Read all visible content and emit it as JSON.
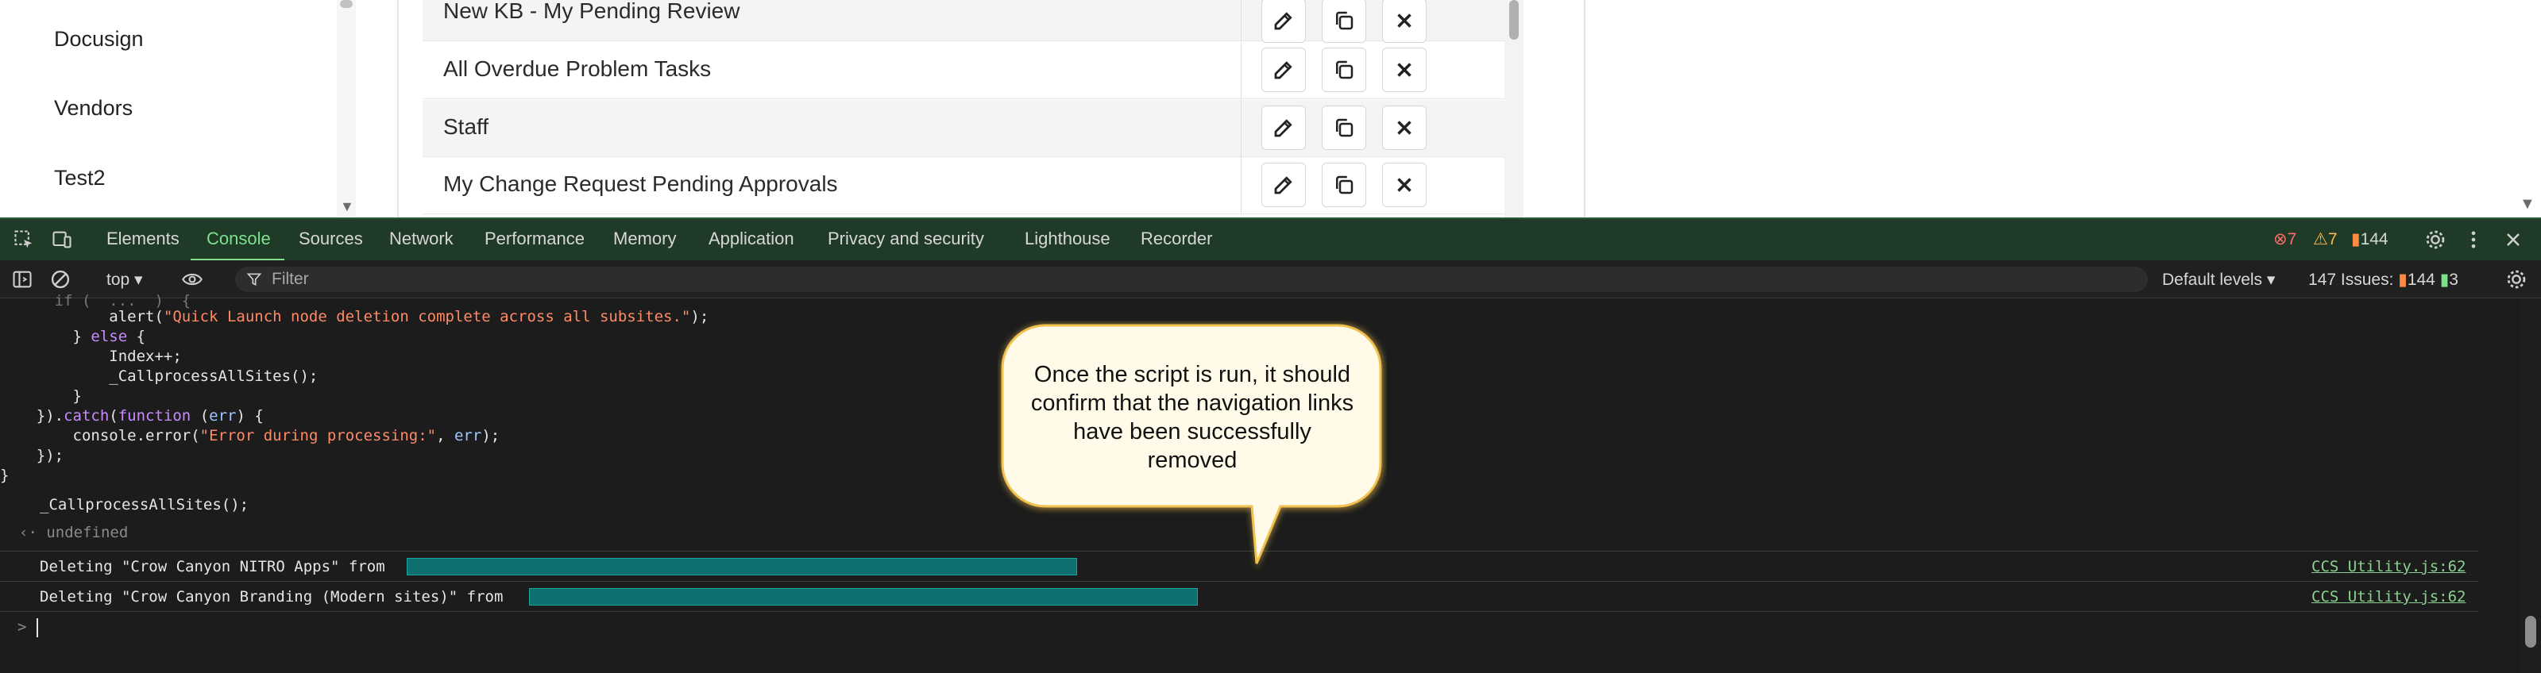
{
  "left_nav": {
    "items": [
      "Docusign",
      "Vendors",
      "Test2"
    ]
  },
  "grid": {
    "rows": [
      {
        "label": "New KB - My Pending Review"
      },
      {
        "label": "All Overdue Problem Tasks"
      },
      {
        "label": "Staff"
      },
      {
        "label": "My Change Request Pending Approvals"
      }
    ],
    "actions": [
      "edit-icon",
      "copy-icon",
      "close-icon"
    ]
  },
  "devtools": {
    "tabs": [
      "Elements",
      "Console",
      "Sources",
      "Network",
      "Performance",
      "Memory",
      "Application",
      "Privacy and security",
      "Lighthouse",
      "Recorder"
    ],
    "active_tab": "Console",
    "badges": {
      "errors": "7",
      "warnings": "7",
      "issues": "144"
    },
    "toolbar": {
      "context": "top",
      "filter_placeholder": "Filter",
      "levels": "Default levels",
      "issues_label": "147 Issues:",
      "issues_err": "144",
      "issues_msg": "3"
    },
    "code_lines": [
      "            alert(\"Quick Launch node deletion complete across all subsites.\");",
      "        } else {",
      "            Index++;",
      "            _CallprocessAllSites();",
      "        }",
      "    }).catch(function (err) {",
      "        console.error(\"Error during processing:\", err);",
      "    });",
      "}",
      "_CallprocessAllSites();"
    ],
    "return_value": "undefined",
    "messages": [
      {
        "text": "Deleting \"Crow Canyon NITRO Apps\" from",
        "source": "CCS Utility.js:62"
      },
      {
        "text": "Deleting \"Crow Canyon Branding (Modern sites)\" from",
        "source": "CCS Utility.js:62"
      }
    ],
    "prompt": ">"
  },
  "callout": {
    "text": "Once the script is run, it should confirm that the navigation links have been successfully removed",
    "fill": "#fffbe8",
    "border": "#f2c14e"
  },
  "colors": {
    "active_tab": "#7ee08e",
    "tabbar_bg": "#1f3a26",
    "string": "#ff8a65",
    "keyword": "#c98bff"
  }
}
